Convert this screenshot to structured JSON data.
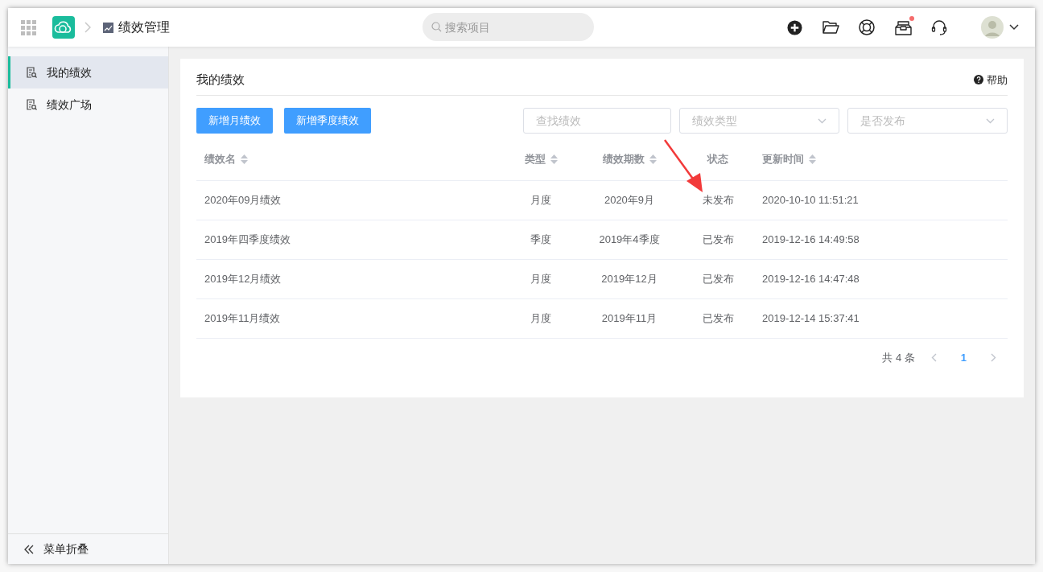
{
  "topbar": {
    "title": "绩效管理",
    "search": {
      "placeholder": "搜索项目"
    },
    "inbox_badge": true
  },
  "sidebar": {
    "items": [
      {
        "label": "我的绩效",
        "selected": true
      },
      {
        "label": "绩效广场",
        "selected": false
      }
    ],
    "collapse_label": "菜单折叠"
  },
  "card": {
    "title": "我的绩效",
    "help": "帮助",
    "buttons": [
      "新增月绩效",
      "新增季度绩效"
    ],
    "search": {
      "placeholder": "查找绩效"
    },
    "filters": [
      {
        "placeholder": "绩效类型"
      },
      {
        "placeholder": "是否发布"
      }
    ],
    "table": {
      "columns": [
        {
          "label": "绩效名",
          "sortable": true
        },
        {
          "label": "类型",
          "sortable": true
        },
        {
          "label": "绩效期数",
          "sortable": true
        },
        {
          "label": "状态",
          "sortable": false
        },
        {
          "label": "更新时间",
          "sortable": true
        }
      ],
      "rows": [
        [
          "2020年09月绩效",
          "月度",
          "2020年9月",
          "未发布",
          "2020-10-10 11:51:21"
        ],
        [
          "2019年四季度绩效",
          "季度",
          "2019年4季度",
          "已发布",
          "2019-12-16 14:49:58"
        ],
        [
          "2019年12月绩效",
          "月度",
          "2019年12月",
          "已发布",
          "2019-12-16 14:47:48"
        ],
        [
          "2019年11月绩效",
          "月度",
          "2019年11月",
          "已发布",
          "2019-12-14 15:37:41"
        ]
      ]
    },
    "pagination": {
      "total": "共 4 条",
      "pages": [
        {
          "label": "1",
          "selected": true
        }
      ]
    }
  }
}
